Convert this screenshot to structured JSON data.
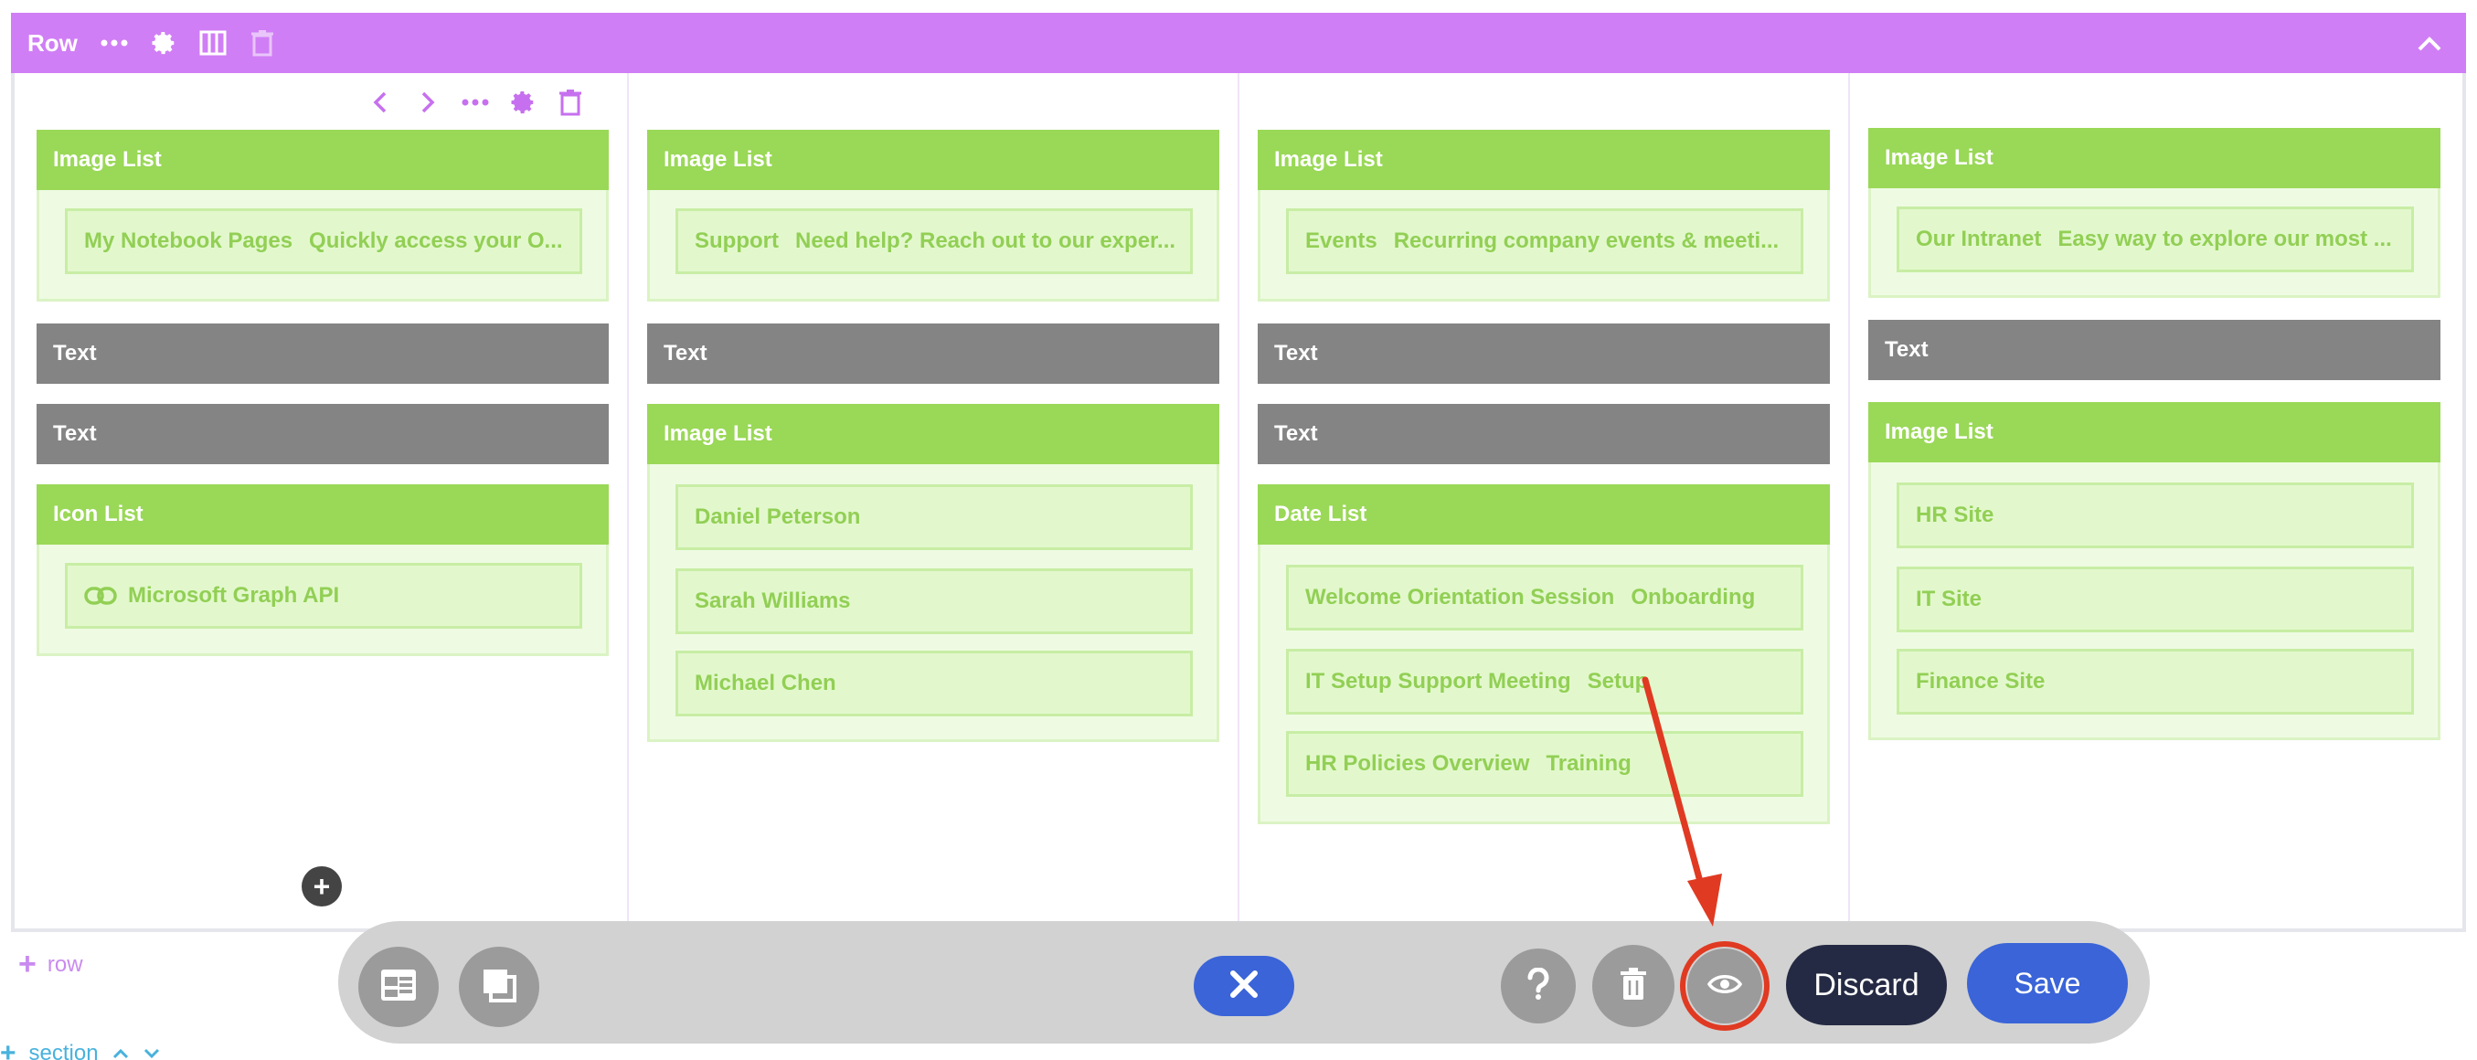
{
  "row_toolbar": {
    "label": "Row"
  },
  "columns": [
    {
      "modules": [
        {
          "type": "green",
          "title": "Image List",
          "items": [
            {
              "title": "My Notebook Pages",
              "desc": "Quickly access your O..."
            }
          ]
        },
        {
          "type": "gray",
          "title": "Text"
        },
        {
          "type": "gray",
          "title": "Text"
        },
        {
          "type": "green",
          "title": "Icon List",
          "items": [
            {
              "title": "Microsoft Graph API",
              "icon": "link-icon"
            }
          ]
        }
      ]
    },
    {
      "modules": [
        {
          "type": "green",
          "title": "Image List",
          "items": [
            {
              "title": "Support",
              "desc": "Need help? Reach out to our exper..."
            }
          ]
        },
        {
          "type": "gray",
          "title": "Text"
        },
        {
          "type": "green",
          "title": "Image List",
          "items": [
            {
              "title": "Daniel Peterson"
            },
            {
              "title": "Sarah Williams"
            },
            {
              "title": "Michael Chen"
            }
          ]
        }
      ]
    },
    {
      "modules": [
        {
          "type": "green",
          "title": "Image List",
          "items": [
            {
              "title": "Events",
              "desc": "Recurring company events & meeti..."
            }
          ]
        },
        {
          "type": "gray",
          "title": "Text"
        },
        {
          "type": "gray",
          "title": "Text"
        },
        {
          "type": "green",
          "title": "Date List",
          "items": [
            {
              "title": "Welcome Orientation Session",
              "desc": "Onboarding"
            },
            {
              "title": "IT Setup Support Meeting",
              "desc": "Setup"
            },
            {
              "title": "HR Policies Overview",
              "desc": "Training"
            }
          ]
        }
      ]
    },
    {
      "modules": [
        {
          "type": "green",
          "title": "Image List",
          "items": [
            {
              "title": "Our Intranet",
              "desc": "Easy way to explore our most ..."
            }
          ]
        },
        {
          "type": "gray",
          "title": "Text"
        },
        {
          "type": "green",
          "title": "Image List",
          "items": [
            {
              "title": "HR Site"
            },
            {
              "title": "IT Site"
            },
            {
              "title": "Finance Site"
            }
          ]
        }
      ]
    }
  ],
  "add_row_label": "row",
  "section_label": "section",
  "bottom_toolbar": {
    "discard_label": "Discard",
    "save_label": "Save"
  },
  "colors": {
    "row_bar": "#d07ef5",
    "module_green": "#9ad857",
    "module_gray": "#848484",
    "primary_blue": "#3a64d8",
    "discard_dark": "#252a44",
    "highlight_red": "#e03a22"
  }
}
